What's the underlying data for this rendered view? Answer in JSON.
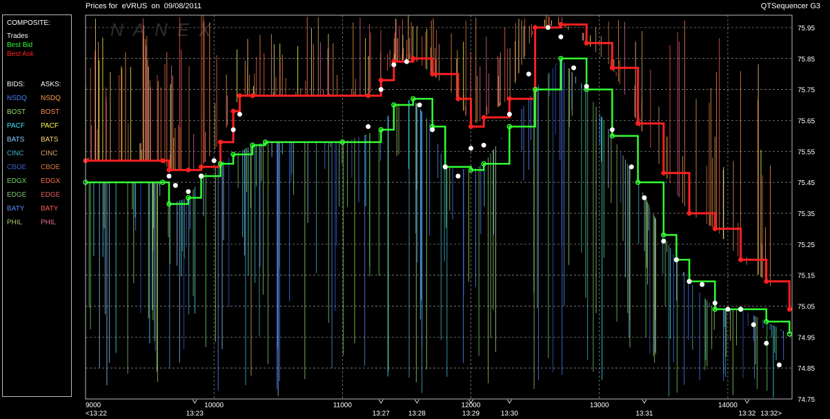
{
  "header": {
    "prices_for": "Prices for",
    "symbol": "eVRUS",
    "on_word": "on",
    "date": "09/08/2011",
    "app_name": "QTSequencer G3"
  },
  "watermark": "NANEX",
  "legend": {
    "composite_label": "COMPOSITE:",
    "trades": "Trades",
    "best_bid": "Best Bid",
    "best_ask": "Best Ask",
    "bids_label": "BIDS:",
    "asks_label": "ASKS:",
    "exchanges": [
      {
        "bid": "NSDQ",
        "ask": "NSDQ",
        "bid_color": "#4a7cff",
        "ask_color": "#ff9e4a"
      },
      {
        "bid": "BOST",
        "ask": "BOST",
        "bid_color": "#9bd96b",
        "ask_color": "#ff8a4a"
      },
      {
        "bid": "PACF",
        "ask": "PACF",
        "bid_color": "#3ee8ff",
        "ask_color": "#ffff4a"
      },
      {
        "bid": "BATS",
        "ask": "BATS",
        "bid_color": "#8ec8ff",
        "ask_color": "#ffd97a"
      },
      {
        "bid": "CINC",
        "ask": "CINC",
        "bid_color": "#3fb7c8",
        "ask_color": "#d9a66b"
      },
      {
        "bid": "CBOE",
        "ask": "CBOE",
        "bid_color": "#3a5fcf",
        "ask_color": "#d97a3a"
      },
      {
        "bid": "EDGX",
        "ask": "EDGX",
        "bid_color": "#6bd96b",
        "ask_color": "#ff6b4a"
      },
      {
        "bid": "EDGE",
        "ask": "EDGE",
        "bid_color": "#7ac86b",
        "ask_color": "#e65c5c"
      },
      {
        "bid": "BATY",
        "ask": "BATY",
        "bid_color": "#5a8cff",
        "ask_color": "#ff5a5a"
      },
      {
        "bid": "PHIL",
        "ask": "PHIL",
        "bid_color": "#a8c86b",
        "ask_color": "#e66b9e"
      }
    ]
  },
  "colors": {
    "trades": "#ffffff",
    "best_bid": "#33ff33",
    "best_ask": "#ff2020",
    "grid": "#9a9a9a",
    "frame": "#bdbdbd"
  },
  "chart_data": {
    "type": "line",
    "ylim": [
      74.75,
      75.99
    ],
    "xlim": [
      9000,
      14500
    ],
    "y_ticks": [
      "75.95",
      "75.85",
      "75.75",
      "75.65",
      "75.55",
      "75.45",
      "75.35",
      "75.25",
      "75.15",
      "75.05",
      "74.95",
      "74.85",
      "74.75"
    ],
    "x_ticks": [
      {
        "x": 9000,
        "label": "9000"
      },
      {
        "x": 10000,
        "label": "10000"
      },
      {
        "x": 11000,
        "label": "11000"
      },
      {
        "x": 12000,
        "label": "12000"
      },
      {
        "x": 13000,
        "label": "13000"
      },
      {
        "x": 14000,
        "label": "14000"
      }
    ],
    "time_labels": [
      {
        "x": 9000,
        "label": "<13:22"
      },
      {
        "x": 9850,
        "label": "13:23"
      },
      {
        "x": 11300,
        "label": "13:27"
      },
      {
        "x": 11580,
        "label": "13:28"
      },
      {
        "x": 12000,
        "label": "13:29"
      },
      {
        "x": 12300,
        "label": "13:30"
      },
      {
        "x": 13350,
        "label": "13:31"
      },
      {
        "x": 14150,
        "label": "13:32"
      },
      {
        "x": 14420,
        "label": "13:32>"
      }
    ],
    "series": [
      {
        "name": "Best Ask",
        "x": [
          9000,
          9600,
          9650,
          9800,
          9900,
          10050,
          10150,
          10200,
          10300,
          11200,
          11300,
          11400,
          11550,
          11700,
          11900,
          12000,
          12100,
          12300,
          12500,
          12700,
          12900,
          13100,
          13300,
          13500,
          13700,
          13900,
          14100,
          14300,
          14480
        ],
        "y": [
          75.52,
          75.52,
          75.49,
          75.49,
          75.5,
          75.58,
          75.68,
          75.73,
          75.73,
          75.73,
          75.78,
          75.84,
          75.85,
          75.8,
          75.72,
          75.63,
          75.66,
          75.72,
          75.95,
          75.96,
          75.9,
          75.82,
          75.64,
          75.48,
          75.35,
          75.3,
          75.2,
          75.13,
          75.04
        ]
      },
      {
        "name": "Best Bid",
        "x": [
          9000,
          9600,
          9650,
          9800,
          9900,
          10050,
          10150,
          10300,
          10400,
          11000,
          11300,
          11400,
          11550,
          11700,
          11800,
          12000,
          12100,
          12300,
          12500,
          12700,
          12900,
          13100,
          13300,
          13500,
          13600,
          13700,
          13900,
          14100,
          14300,
          14480
        ],
        "y": [
          75.45,
          75.45,
          75.38,
          75.4,
          75.47,
          75.51,
          75.54,
          75.57,
          75.58,
          75.58,
          75.62,
          75.7,
          75.72,
          75.63,
          75.5,
          75.49,
          75.51,
          75.63,
          75.75,
          75.85,
          75.75,
          75.6,
          75.45,
          75.28,
          75.2,
          75.13,
          75.04,
          75.04,
          75.0,
          74.96
        ]
      },
      {
        "name": "Trades",
        "x": [
          9650,
          9700,
          9800,
          9900,
          10000,
          10150,
          10200,
          11200,
          11300,
          11400,
          11500,
          11600,
          11700,
          11800,
          11900,
          12000,
          12100,
          12300,
          12450,
          12600,
          12700,
          12800,
          12900,
          13100,
          13250,
          13350,
          13500,
          13600,
          13700,
          13800,
          13900,
          14000,
          14100,
          14200,
          14300,
          14400
        ],
        "y": [
          75.47,
          75.44,
          75.42,
          75.47,
          75.52,
          75.62,
          75.67,
          75.63,
          75.75,
          75.83,
          75.84,
          75.7,
          75.62,
          75.5,
          75.47,
          75.56,
          75.57,
          75.67,
          75.8,
          75.95,
          75.92,
          75.82,
          75.76,
          75.62,
          75.5,
          75.4,
          75.26,
          75.2,
          75.13,
          75.12,
          75.06,
          75.04,
          75.04,
          74.99,
          74.93,
          74.86
        ]
      }
    ]
  }
}
